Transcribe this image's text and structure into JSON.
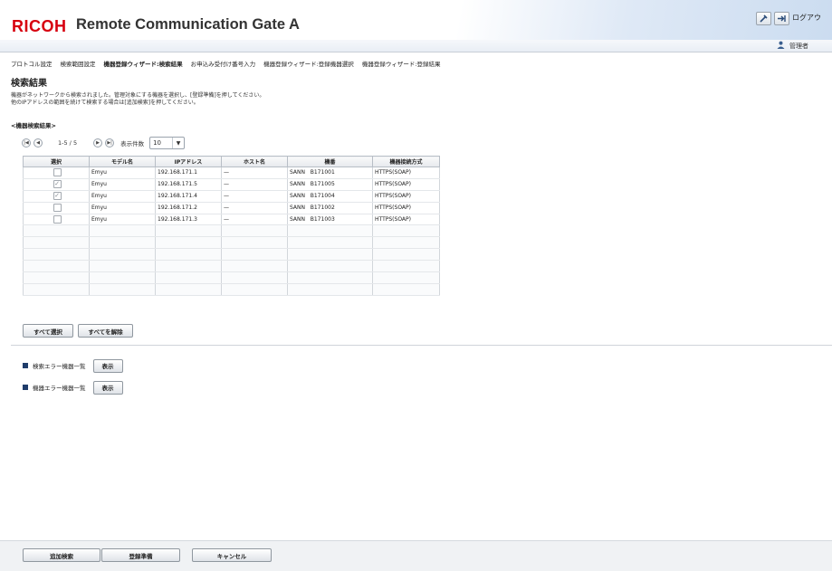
{
  "header": {
    "brand": "RICOH",
    "product": "Remote Communication Gate A",
    "tools_icon": "wrench-icon",
    "logout_icon": "logout-arrow-icon",
    "logout_label": "ログアウ",
    "user_label": "管理者"
  },
  "menu": [
    {
      "label": "プロトコル設定",
      "active": false
    },
    {
      "label": "検索範囲設定",
      "active": false
    },
    {
      "label": "機器登録ウィザード:検索結果",
      "active": true
    },
    {
      "label": "お申込み受付け番号入力",
      "active": false
    },
    {
      "label": "機器登録ウィザード:登録機器選択",
      "active": false
    },
    {
      "label": "機器登録ウィザード:登録結果",
      "active": false
    }
  ],
  "page": {
    "title": "検索結果",
    "desc_line1": "機器がネットワークから検索されました。管理対象にする機器を選択し、[登録準備]を押してください。",
    "desc_line2": "他のIPアドレスの範囲を続けて検索する場合は[追加検索]を押してください。",
    "section": "<機器検索結果>"
  },
  "pager": {
    "range": "1-5 / 5",
    "per_page_label": "表示件数",
    "per_page_value": "10"
  },
  "table": {
    "headers": [
      "選択",
      "モデル名",
      "IPアドレス",
      "ホスト名",
      "機番",
      "機器接続方式"
    ],
    "rows": [
      {
        "checked": false,
        "model": "Emyu",
        "ip": "192.168.171.1",
        "host": "—",
        "serial_a": "SANN",
        "serial_b": "B171001",
        "conn": "HTTPS(SOAP)"
      },
      {
        "checked": true,
        "model": "Emyu",
        "ip": "192.168.171.5",
        "host": "—",
        "serial_a": "SANN",
        "serial_b": "B171005",
        "conn": "HTTPS(SOAP)"
      },
      {
        "checked": true,
        "model": "Emyu",
        "ip": "192.168.171.4",
        "host": "—",
        "serial_a": "SANN",
        "serial_b": "B171004",
        "conn": "HTTPS(SOAP)"
      },
      {
        "checked": false,
        "model": "Emyu",
        "ip": "192.168.171.2",
        "host": "—",
        "serial_a": "SANN",
        "serial_b": "B171002",
        "conn": "HTTPS(SOAP)"
      },
      {
        "checked": false,
        "model": "Emyu",
        "ip": "192.168.171.3",
        "host": "—",
        "serial_a": "SANN",
        "serial_b": "B171003",
        "conn": "HTTPS(SOAP)"
      }
    ]
  },
  "buttons": {
    "select_all": "すべて選択",
    "deselect_all": "すべてを解除",
    "show": "表示",
    "add_search": "追加検索",
    "prepare": "登録準備",
    "cancel": "キャンセル"
  },
  "errors": {
    "search_error_list": "検索エラー機器一覧",
    "device_error_list": "機器エラー機器一覧"
  },
  "colors": {
    "brand_red": "#d7000f",
    "accent_navy": "#1f3d6b"
  }
}
